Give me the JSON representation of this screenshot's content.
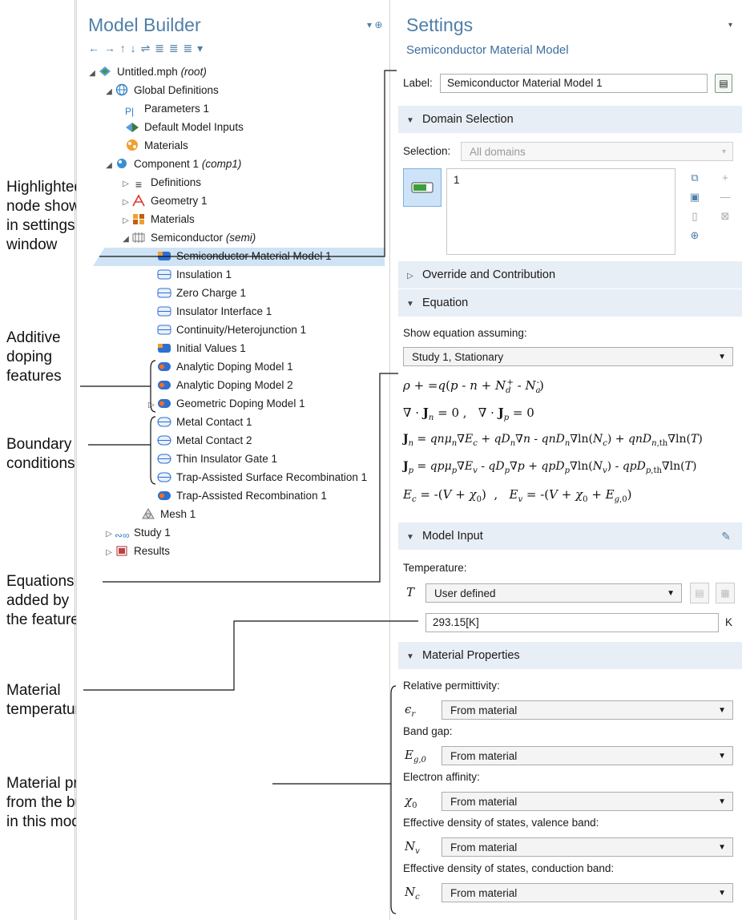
{
  "annotations": {
    "highlighted": [
      "Highlighted",
      "node shown",
      "in settings",
      "window"
    ],
    "doping": [
      "Additive",
      "doping",
      "features"
    ],
    "boundary": [
      "Boundary",
      "conditions"
    ],
    "equations": [
      "Equations",
      "added by",
      "the feature"
    ],
    "temperature": [
      "Material",
      "temperature"
    ],
    "properties": [
      "Material properties are obtained",
      "from the built-in material library",
      "in this model"
    ]
  },
  "model_builder": {
    "title": "Model Builder",
    "toolbar": [
      "←",
      "→",
      "↑",
      "↓",
      "⇌",
      "≣",
      "≣",
      "≣",
      "▾"
    ],
    "tree": [
      {
        "label": "Untitled.mph",
        "suffix": "(root)"
      },
      {
        "label": "Global Definitions",
        "suffix": ""
      },
      {
        "label": "Parameters 1",
        "suffix": "",
        "icon_text": "P|"
      },
      {
        "label": "Default Model Inputs",
        "suffix": ""
      },
      {
        "label": "Materials",
        "suffix": ""
      },
      {
        "label": "Component 1",
        "suffix": "(comp1)"
      },
      {
        "label": "Definitions",
        "suffix": ""
      },
      {
        "label": "Geometry 1",
        "suffix": ""
      },
      {
        "label": "Materials",
        "suffix": ""
      },
      {
        "label": "Semiconductor",
        "suffix": "(semi)"
      },
      {
        "label": "Semiconductor Material Model 1",
        "suffix": ""
      },
      {
        "label": "Insulation 1",
        "suffix": ""
      },
      {
        "label": "Zero Charge 1",
        "suffix": ""
      },
      {
        "label": "Insulator Interface 1",
        "suffix": ""
      },
      {
        "label": "Continuity/Heterojunction 1",
        "suffix": ""
      },
      {
        "label": "Initial Values 1",
        "suffix": ""
      },
      {
        "label": "Analytic Doping Model 1",
        "suffix": ""
      },
      {
        "label": "Analytic Doping Model 2",
        "suffix": ""
      },
      {
        "label": "Geometric Doping Model 1",
        "suffix": ""
      },
      {
        "label": "Metal Contact 1",
        "suffix": ""
      },
      {
        "label": "Metal Contact 2",
        "suffix": ""
      },
      {
        "label": "Thin Insulator Gate 1",
        "suffix": ""
      },
      {
        "label": "Trap-Assisted Surface Recombination 1",
        "suffix": ""
      },
      {
        "label": "Trap-Assisted Recombination 1",
        "suffix": ""
      },
      {
        "label": "Mesh 1",
        "suffix": ""
      },
      {
        "label": "Study 1",
        "suffix": ""
      },
      {
        "label": "Results",
        "suffix": ""
      }
    ]
  },
  "settings": {
    "title": "Settings",
    "subtitle": "Semiconductor Material Model",
    "label_caption": "Label:",
    "label_value": "Semiconductor Material Model 1",
    "sections": {
      "domain": "Domain Selection",
      "override": "Override and Contribution",
      "equation": "Equation",
      "model_input": "Model Input",
      "material": "Material Properties"
    },
    "selection_caption": "Selection:",
    "selection_value": "All domains",
    "selection_list_item": "1",
    "show_eq_caption": "Show equation assuming:",
    "study_value": "Study 1, Stationary",
    "temperature_caption": "Temperature:",
    "temperature_symbol": "T",
    "temperature_mode": "User defined",
    "temperature_value": "293.15[K]",
    "temperature_unit": "K",
    "properties": [
      {
        "caption": "Relative permittivity:",
        "value": "From material"
      },
      {
        "caption": "Band gap:",
        "value": "From material"
      },
      {
        "caption": "Electron affinity:",
        "value": "From material"
      },
      {
        "caption": "Effective density of states, valence band:",
        "value": "From material"
      },
      {
        "caption": "Effective density of states, conduction band:",
        "value": "From material"
      }
    ]
  },
  "colors": {
    "accent": "#4f7fa8",
    "selection": "#cfe3f5",
    "section": "#e8eef5"
  }
}
